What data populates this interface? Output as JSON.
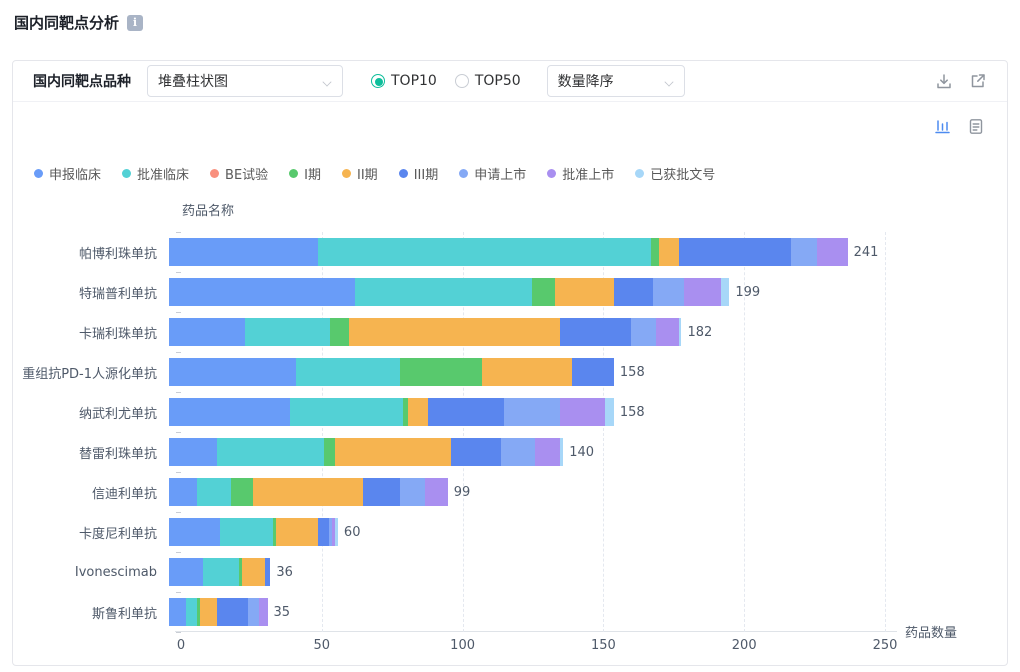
{
  "page": {
    "title": "国内同靶点分析"
  },
  "toolbar": {
    "label": "国内同靶点品种",
    "chart_type_select": {
      "value": "堆叠柱状图"
    },
    "radios": [
      {
        "label": "TOP10",
        "selected": true
      },
      {
        "label": "TOP50",
        "selected": false
      }
    ],
    "sort_select": {
      "value": "数量降序"
    }
  },
  "icons": {
    "info": "info-icon",
    "download": "download-icon",
    "external_link": "external-link-icon",
    "bar_chart_view": "bar-chart-icon",
    "table_view": "document-icon"
  },
  "colors": {
    "accent": "#0EBE9B",
    "active_icon_blue": "#4D8BF0",
    "axis_text": "#4E5969",
    "grid": "#E4E8EF"
  },
  "chart_data": {
    "type": "bar",
    "orientation": "horizontal",
    "stacked": true,
    "xlabel": "药品数量",
    "ylabel": "药品名称",
    "xlim": [
      0,
      250
    ],
    "xticks": [
      0,
      50,
      100,
      150,
      200,
      250
    ],
    "grid": "dashed-vertical",
    "legend_position": "top",
    "categories": [
      "帕博利珠单抗",
      "特瑞普利单抗",
      "卡瑞利珠单抗",
      "重组抗PD-1人源化单抗",
      "纳武利尤单抗",
      "替雷利珠单抗",
      "信迪利单抗",
      "卡度尼利单抗",
      "Ivonescimab",
      "斯鲁利单抗"
    ],
    "totals": [
      241,
      199,
      182,
      158,
      158,
      140,
      99,
      60,
      36,
      35
    ],
    "series": [
      {
        "name": "申报临床",
        "color": "#699CF8",
        "values": [
          53,
          66,
          27,
          45,
          43,
          17,
          10,
          18,
          12,
          6
        ]
      },
      {
        "name": "批准临床",
        "color": "#53D1D5",
        "values": [
          118,
          63,
          30,
          37,
          40,
          38,
          12,
          19,
          13,
          4
        ]
      },
      {
        "name": "BE试验",
        "color": "#F9907E",
        "values": [
          0,
          0,
          0,
          0,
          0,
          0,
          0,
          0,
          0,
          0
        ]
      },
      {
        "name": "I期",
        "color": "#58C96D",
        "values": [
          3,
          8,
          7,
          29,
          2,
          4,
          8,
          1,
          1,
          1
        ]
      },
      {
        "name": "II期",
        "color": "#F6B450",
        "values": [
          7,
          21,
          75,
          32,
          7,
          41,
          39,
          15,
          8,
          6
        ]
      },
      {
        "name": "III期",
        "color": "#5A86EE",
        "values": [
          40,
          14,
          25,
          15,
          27,
          18,
          13,
          4,
          2,
          11
        ]
      },
      {
        "name": "申请上市",
        "color": "#85A9F5",
        "values": [
          9,
          11,
          9,
          0,
          20,
          12,
          9,
          1,
          0,
          4
        ]
      },
      {
        "name": "批准上市",
        "color": "#A98FF0",
        "values": [
          11,
          13,
          8,
          0,
          16,
          9,
          8,
          1,
          0,
          3
        ]
      },
      {
        "name": "已获批文号",
        "color": "#A7D7F8",
        "values": [
          0,
          3,
          1,
          0,
          3,
          1,
          0,
          1,
          0,
          0
        ]
      }
    ]
  }
}
